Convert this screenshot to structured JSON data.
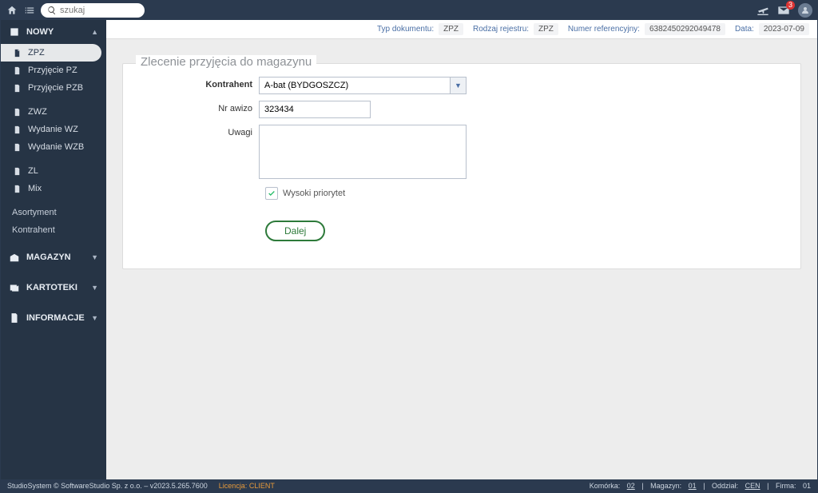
{
  "topbar": {
    "search_placeholder": "szukaj",
    "mail_badge": "3"
  },
  "sidebar": {
    "sections": {
      "nowy": {
        "label": "NOWY"
      },
      "magazyn": {
        "label": "MAGAZYN"
      },
      "kartoteki": {
        "label": "KARTOTEKI"
      },
      "informacje": {
        "label": "INFORMACJE"
      }
    },
    "items": {
      "zpz": "ZPZ",
      "przyjecie_pz": "Przyjęcie PZ",
      "przyjecie_pzb": "Przyjęcie PZB",
      "zwz": "ZWZ",
      "wydanie_wz": "Wydanie WZ",
      "wydanie_wzb": "Wydanie WZB",
      "zl": "ZL",
      "mix": "Mix",
      "asortyment": "Asortyment",
      "kontrahent": "Kontrahent"
    }
  },
  "infobar": {
    "typ_dokumentu_label": "Typ dokumentu:",
    "typ_dokumentu_val": "ZPZ",
    "rodzaj_rejestru_label": "Rodzaj rejestru:",
    "rodzaj_rejestru_val": "ZPZ",
    "numer_ref_label": "Numer referencyjny:",
    "numer_ref_val": "6382450292049478",
    "data_label": "Data:",
    "data_val": "2023-07-09"
  },
  "form": {
    "legend": "Zlecenie przyjęcia do magazynu",
    "kontrahent_label": "Kontrahent",
    "kontrahent_val": "A-bat (BYDGOSZCZ)",
    "nr_awizo_label": "Nr awizo",
    "nr_awizo_val": "323434",
    "uwagi_label": "Uwagi",
    "uwagi_val": "",
    "wysoki_priorytet_label": "Wysoki priorytet",
    "dalej_label": "Dalej"
  },
  "footer": {
    "copyright": "StudioSystem © SoftwareStudio Sp. z o.o. – v2023.5.265.7600",
    "licencja_label": "Licencja: CLIENT",
    "komorka_label": "Komórka:",
    "komorka_val": "02",
    "magazyn_label": "Magazyn:",
    "magazyn_val": "01",
    "oddzial_label": "Oddział:",
    "oddzial_val": "CEN",
    "firma_label": "Firma:",
    "firma_val": "01"
  }
}
